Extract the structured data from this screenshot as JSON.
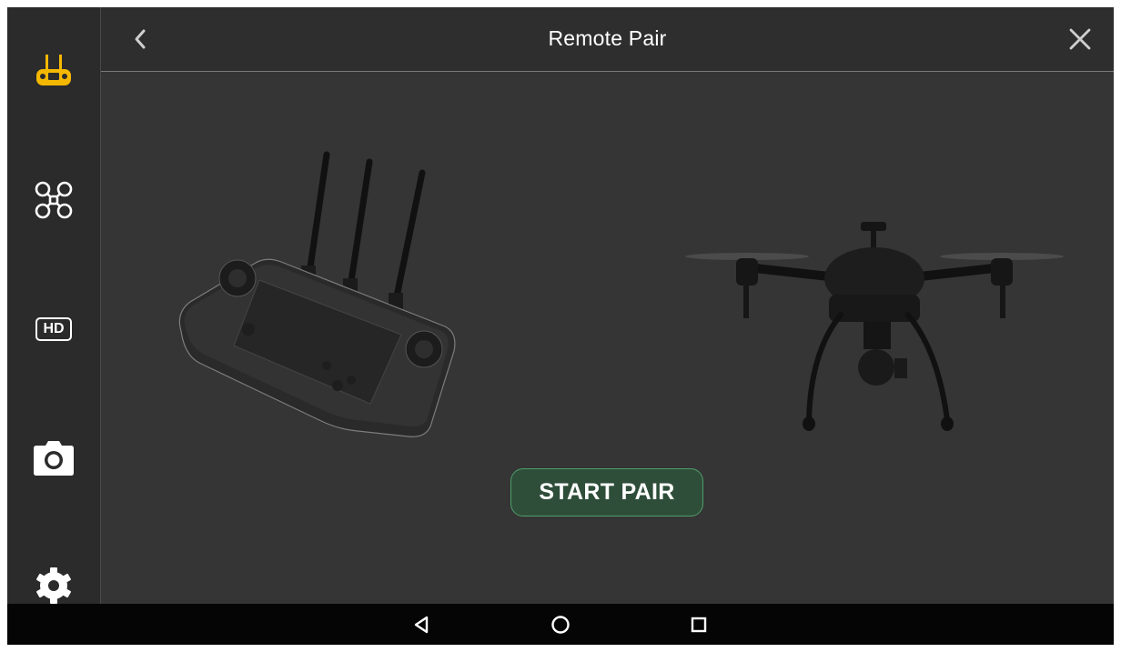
{
  "header": {
    "title": "Remote Pair",
    "back_icon": "chevron-left-icon",
    "close_icon": "close-icon"
  },
  "sidebar": {
    "items": [
      {
        "id": "remote-controller",
        "icon": "remote-controller-icon",
        "active": true
      },
      {
        "id": "drone",
        "icon": "drone-icon",
        "active": false
      },
      {
        "id": "hd-transmission",
        "icon": "hd-icon",
        "label": "HD",
        "active": false
      },
      {
        "id": "camera",
        "icon": "camera-icon",
        "active": false
      },
      {
        "id": "settings",
        "icon": "gear-icon",
        "active": false
      }
    ]
  },
  "main": {
    "start_pair_label": "START PAIR",
    "remote_image": "remote-controller-image",
    "drone_image": "drone-image"
  },
  "navbar": {
    "items": [
      "back-icon",
      "home-icon",
      "recents-icon"
    ]
  },
  "colors": {
    "accent": "#f5b800",
    "button_border": "#4f9d69",
    "button_fill": "#2f4e3a",
    "background": "#353535"
  }
}
